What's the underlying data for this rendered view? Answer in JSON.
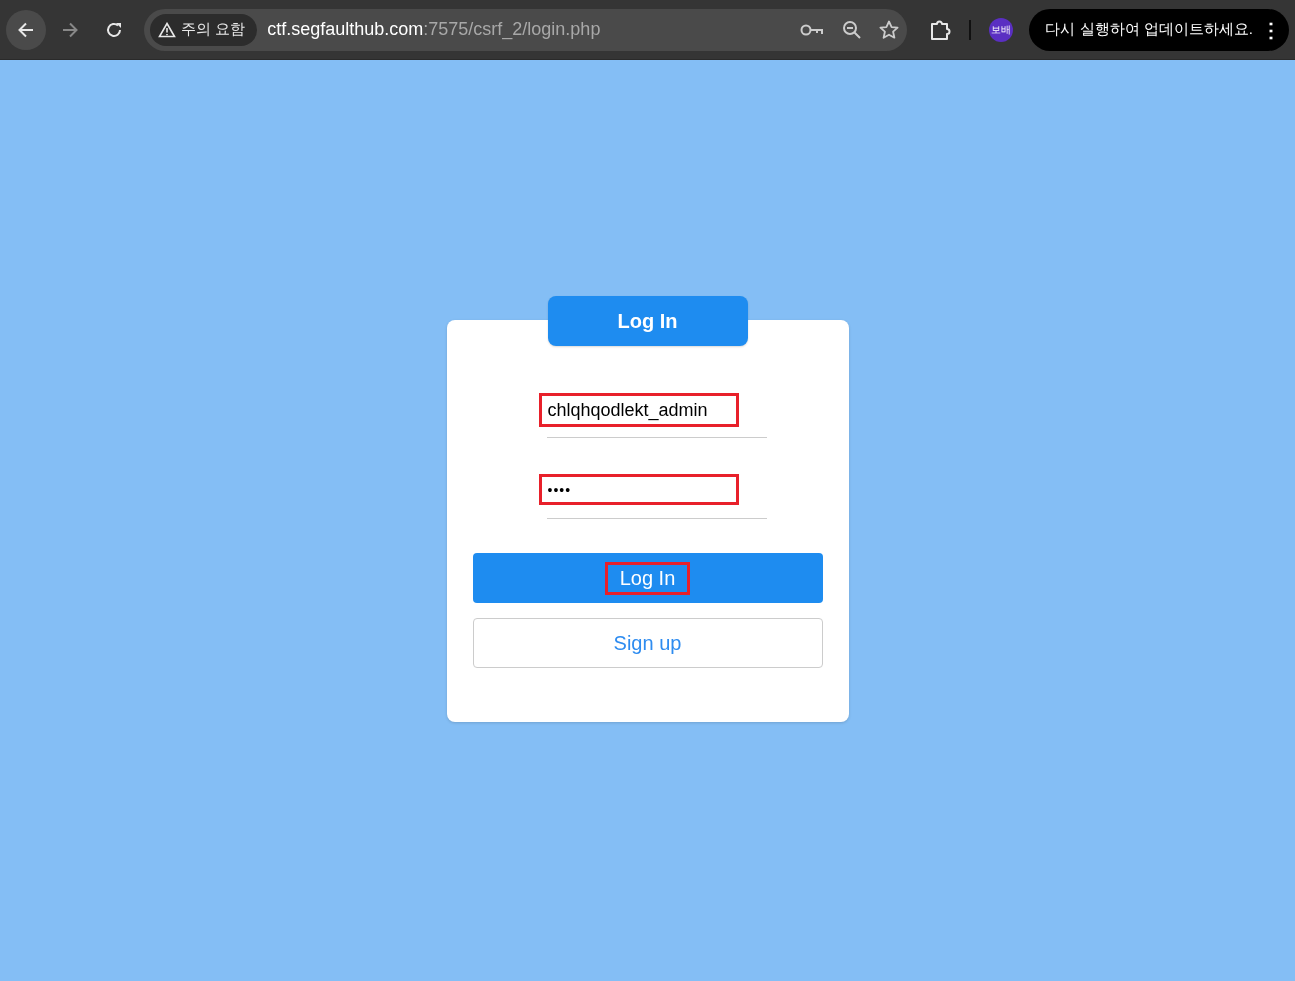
{
  "browser": {
    "security_chip": "주의 요함",
    "url": {
      "host": "ctf.segfaulthub.com",
      "path": ":7575/csrf_2/login.php"
    },
    "profile": "보배",
    "update_button": "다시 실행하여 업데이트하세요.",
    "menu": "⋮"
  },
  "login": {
    "title": "Log In",
    "fields": [
      {
        "kind": "text",
        "value": "chlqhqodlekt_admin",
        "highlighted": true
      },
      {
        "kind": "password",
        "value": "••••",
        "highlighted": true
      }
    ],
    "submit": {
      "label": "Log In",
      "highlighted": true
    },
    "signup": {
      "label": "Sign up"
    }
  }
}
